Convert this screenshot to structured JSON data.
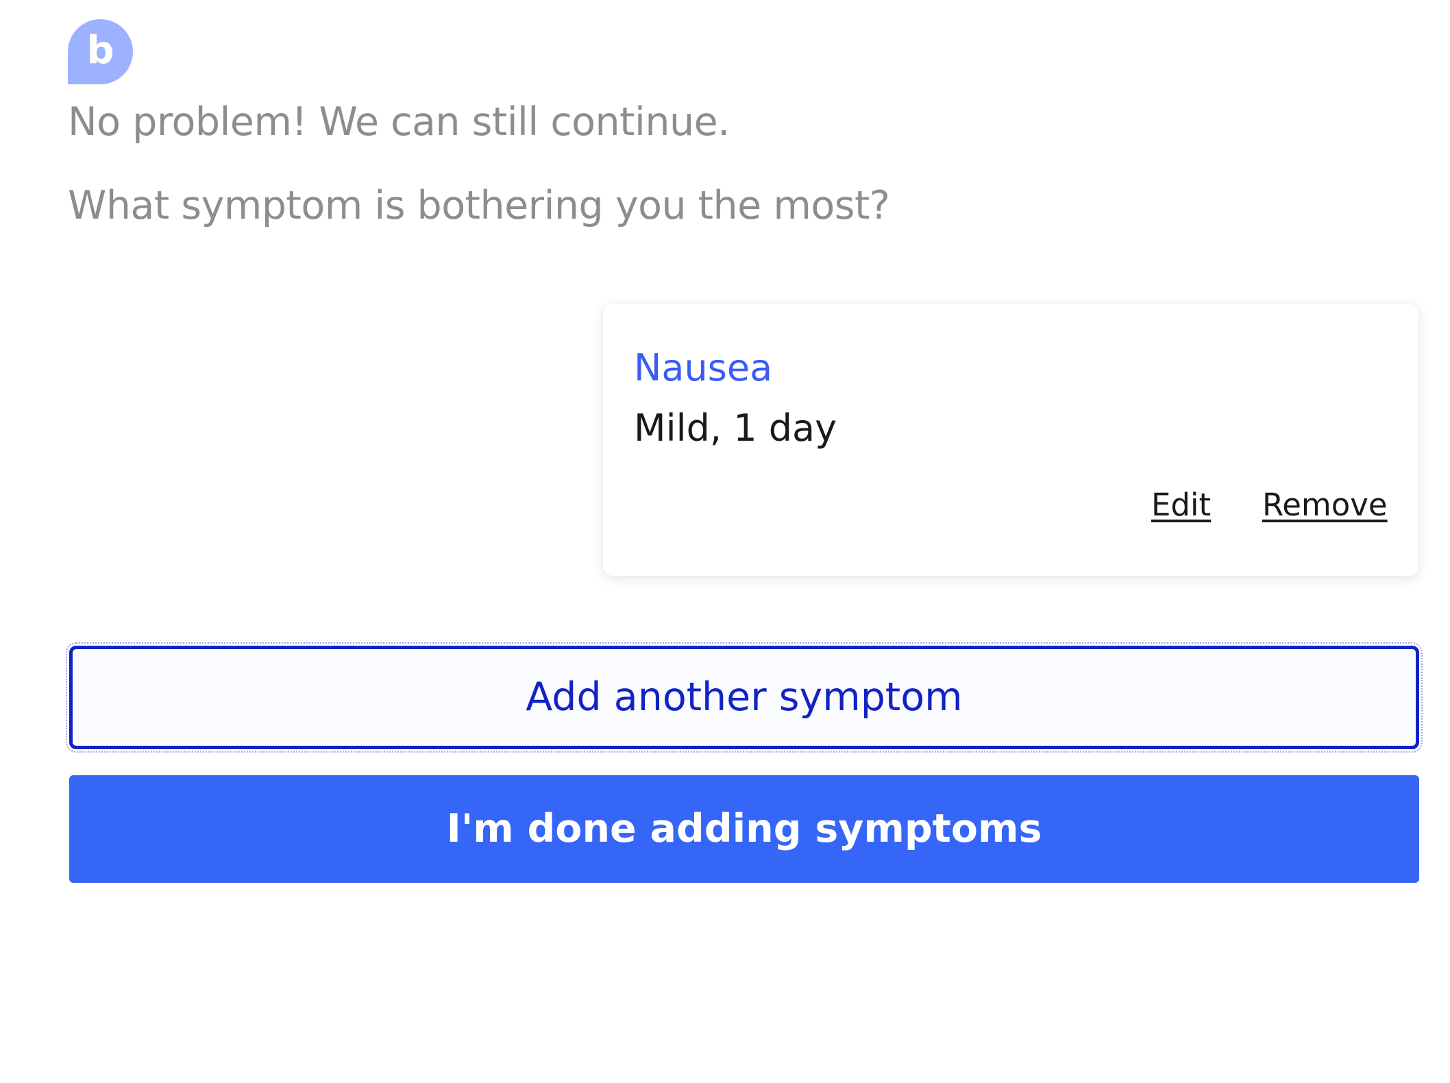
{
  "bot": {
    "avatar_letter": "b",
    "messages": [
      "No problem! We can still continue.",
      "What symptom is bothering you the most?"
    ]
  },
  "symptom_card": {
    "name": "Nausea",
    "detail": "Mild, 1 day",
    "edit_label": "Edit",
    "remove_label": "Remove"
  },
  "actions": {
    "add_label": "Add another symptom",
    "done_label": "I'm done adding symptoms"
  },
  "colors": {
    "accent": "#3566f8",
    "secondary_border": "#1222c4",
    "avatar": "#9cb2ff",
    "bot_text": "#8d8d8d"
  }
}
